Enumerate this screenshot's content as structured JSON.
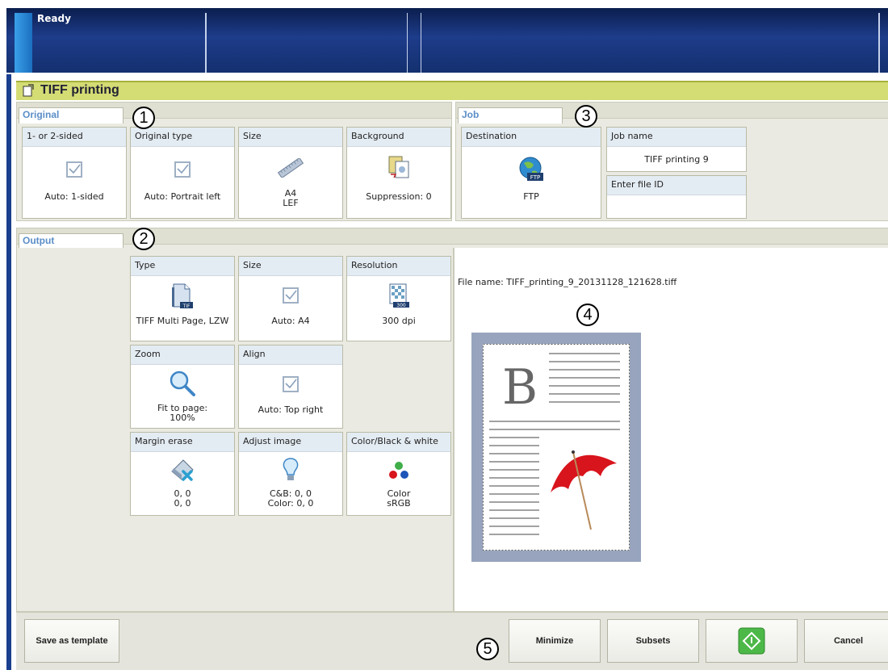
{
  "status": {
    "text": "Ready"
  },
  "window": {
    "title": "TIFF printing"
  },
  "original": {
    "tab": "Original",
    "tiles": [
      {
        "label": "1- or 2-sided",
        "value": "Auto: 1-sided",
        "icon": "checkbox-icon"
      },
      {
        "label": "Original type",
        "value": "Auto: Portrait left",
        "icon": "checkbox-icon"
      },
      {
        "label": "Size",
        "value": "A4",
        "value2": "LEF",
        "icon": "ruler-icon"
      },
      {
        "label": "Background",
        "value": "Suppression: 0",
        "icon": "background-icon"
      }
    ]
  },
  "job": {
    "tab": "Job",
    "destination": {
      "label": "Destination",
      "value": "FTP",
      "icon": "ftp-globe-icon"
    },
    "job_name": {
      "label": "Job name",
      "value": "TIFF printing 9"
    },
    "file_id": {
      "label": "Enter file ID",
      "value": ""
    }
  },
  "output": {
    "tab": "Output",
    "tiles": [
      {
        "label": "Type",
        "value": "TIFF Multi Page, LZW",
        "icon": "tiff-file-icon"
      },
      {
        "label": "Size",
        "value": "Auto: A4",
        "icon": "checkbox-icon"
      },
      {
        "label": "Resolution",
        "value": "300 dpi",
        "icon": "resolution-icon"
      },
      {
        "label": "Zoom",
        "value": "Fit to page:",
        "value2": "100%",
        "icon": "magnifier-icon"
      },
      {
        "label": "Align",
        "value": "Auto: Top right",
        "icon": "checkbox-icon"
      },
      {
        "label": "Margin erase",
        "value": "0, 0",
        "value2": "0, 0",
        "icon": "eraser-icon"
      },
      {
        "label": "Adjust image",
        "value": "C&B: 0, 0",
        "value2": "Color: 0, 0",
        "icon": "lightbulb-icon"
      },
      {
        "label": "Color/Black & white",
        "value": "Color",
        "value2": "sRGB",
        "icon": "color-dots-icon"
      }
    ]
  },
  "preview": {
    "file_name": "File name: TIFF_printing_9_20131128_121628.tiff",
    "letter": "B"
  },
  "buttons": {
    "save_template": "Save as template",
    "minimize": "Minimize",
    "subsets": "Subsets",
    "cancel": "Cancel"
  },
  "callouts": [
    "1",
    "2",
    "3",
    "4",
    "5"
  ],
  "colors": {
    "accent": "#5b8ec8",
    "titlebar": "#d4dc74",
    "start_green": "#4cb848",
    "umbrella_red": "#d8141c"
  }
}
